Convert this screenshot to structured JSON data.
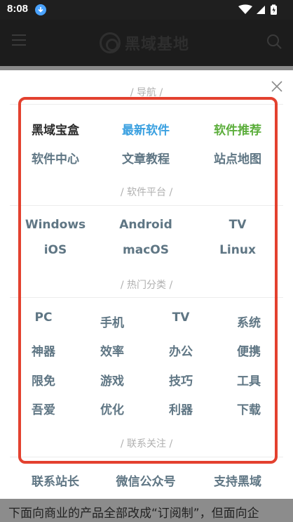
{
  "status_bar": {
    "time": "8:08"
  },
  "app_bar": {
    "logo_text": "黑域基地"
  },
  "sections": {
    "nav": {
      "title": "/ 导航 /",
      "links": [
        {
          "label": "黑域宝盒",
          "color": "#2b2b2b"
        },
        {
          "label": "最新软件",
          "color": "#3aa0e0"
        },
        {
          "label": "软件推荐",
          "color": "#5cae3c"
        },
        {
          "label": "软件中心",
          "color": "#5f7684"
        },
        {
          "label": "文章教程",
          "color": "#5f7684"
        },
        {
          "label": "站点地图",
          "color": "#5f7684"
        }
      ]
    },
    "platform": {
      "title": "/ 软件平台 /",
      "links": [
        "Windows",
        "Android",
        "TV",
        "iOS",
        "macOS",
        "Linux"
      ]
    },
    "hot": {
      "title": "/ 热门分类 /",
      "links": [
        "PC",
        "手机",
        "TV",
        "系统",
        "神器",
        "效率",
        "办公",
        "便携",
        "限免",
        "游戏",
        "技巧",
        "工具",
        "吾爱",
        "优化",
        "利器",
        "下载"
      ]
    },
    "contact": {
      "title": "/ 联系关注 /",
      "links": [
        "联系站长",
        "微信公众号",
        "支持黑域"
      ]
    }
  },
  "background_text": "下面向商业的产品全部改成“订阅制”，但面向企",
  "colors": {
    "highlight_frame": "#e3412f",
    "link_default": "#5f7684",
    "link_blue": "#3aa0e0",
    "link_green": "#5cae3c"
  }
}
